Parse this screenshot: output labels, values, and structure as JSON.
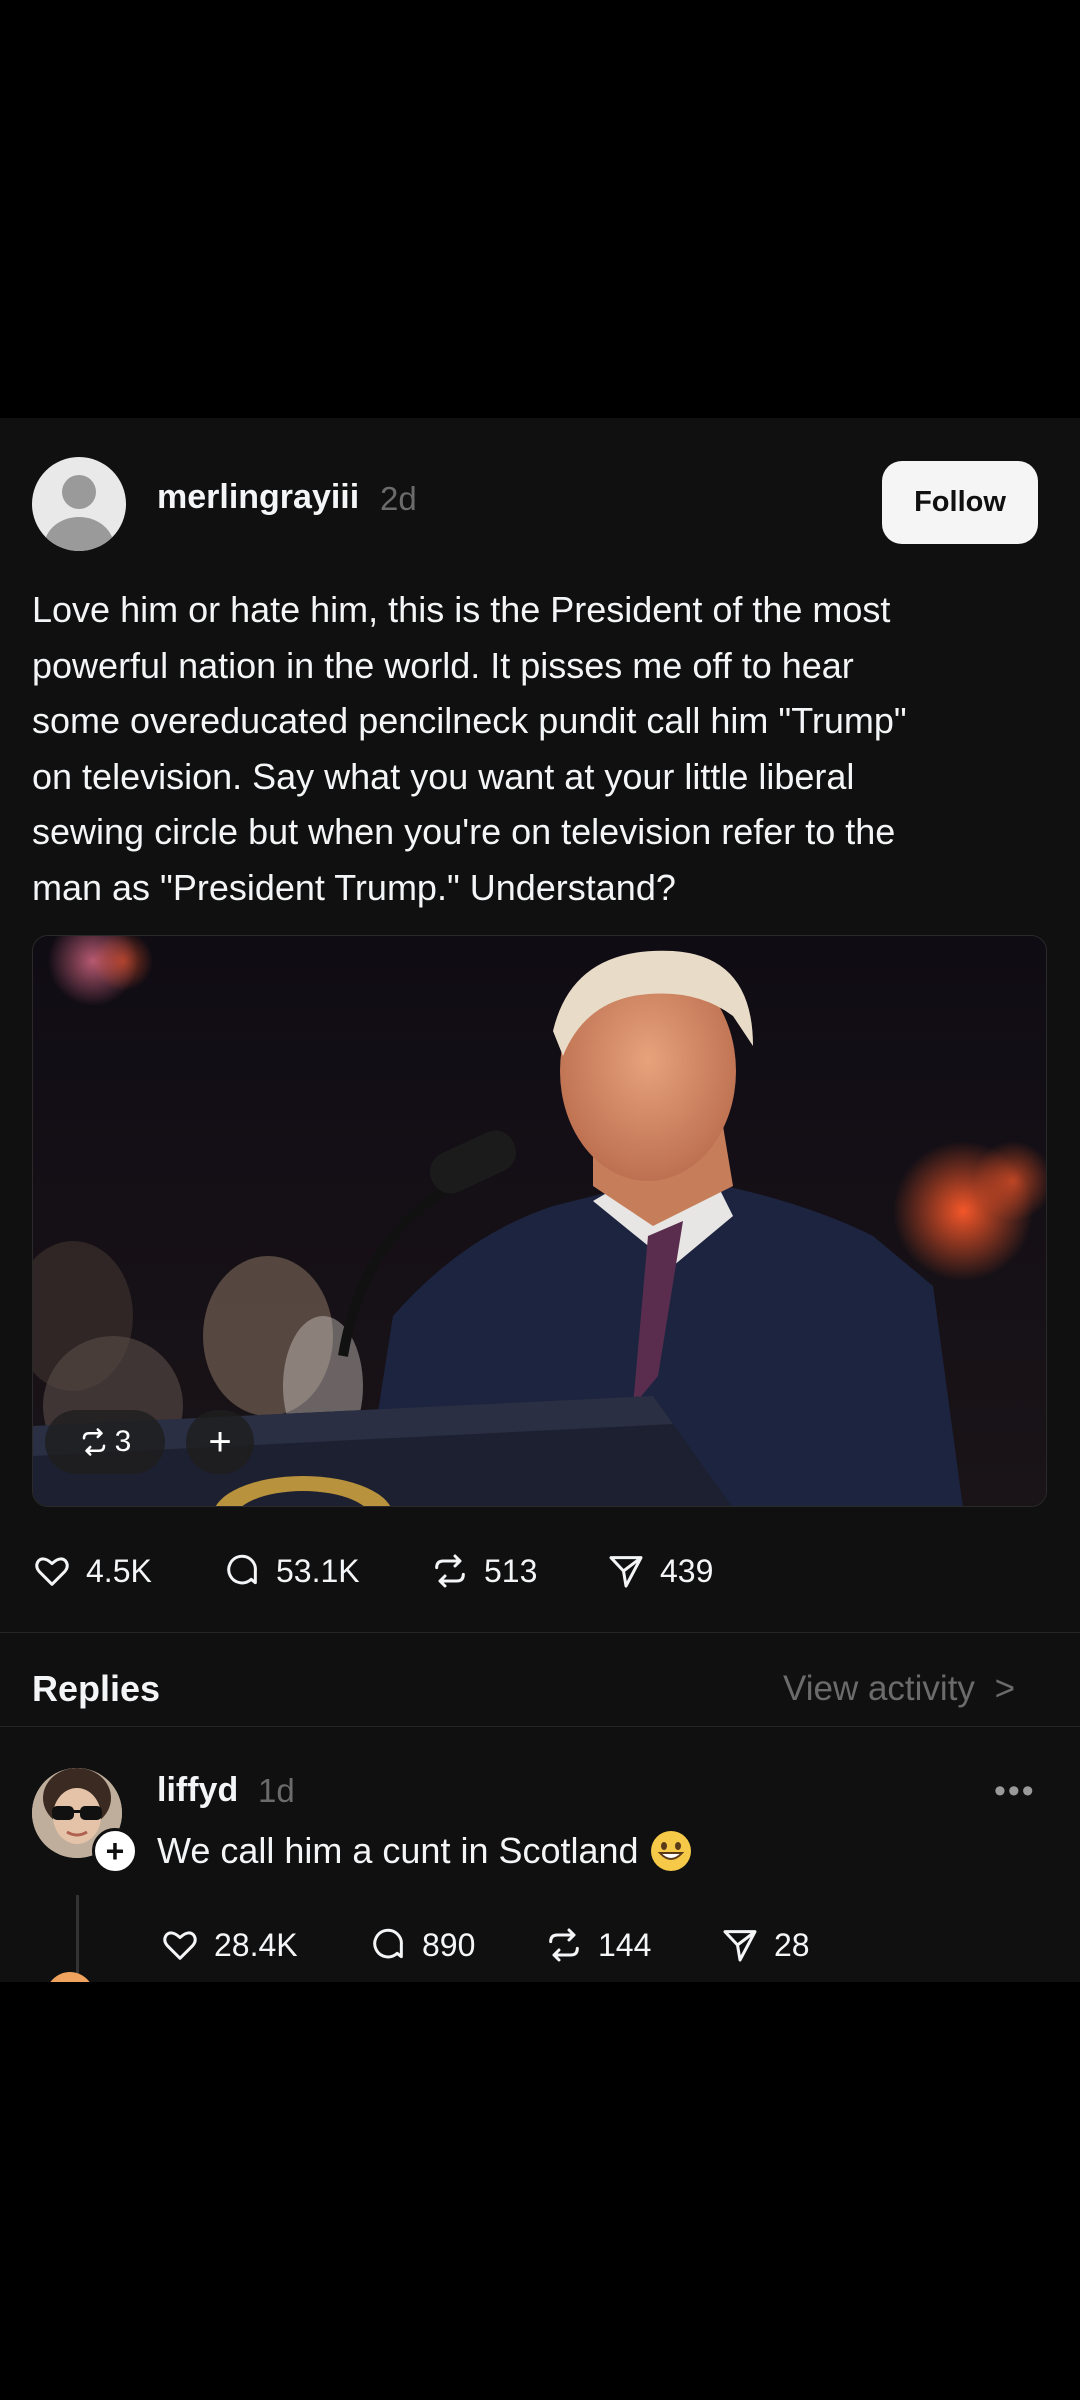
{
  "post": {
    "username": "merlingrayiii",
    "time": "2d",
    "follow_label": "Follow",
    "text": "Love him or hate him, this is the President of the most\npowerful nation in the world. It pisses me off to hear\nsome overeducated pencilneck pundit call him \"Trump\"\non television.  Say what you want at your little liberal\nsewing circle but when you're on television refer to the\nman as \"President Trump.\" Understand?",
    "media_repost_count": "3",
    "media_plus_label": "+",
    "stats": {
      "likes": "4.5K",
      "comments": "53.1K",
      "reposts": "513",
      "shares": "439"
    }
  },
  "replies_section": {
    "label": "Replies",
    "view_activity_label": "View activity",
    "chevron": ">"
  },
  "reply": {
    "username": "liffyd",
    "time": "1d",
    "more_label": "•••",
    "text": "We call him a cunt in Scotland",
    "emoji": "grinning-face-icon",
    "stats": {
      "likes": "28.4K",
      "comments": "890",
      "reposts": "144",
      "shares": "28"
    }
  },
  "colors": {
    "background": "#000000",
    "post_bg": "#101010",
    "text_primary": "#f3f5f7",
    "text_secondary": "#6b6b6b",
    "follow_bg": "#f5f5f5"
  }
}
